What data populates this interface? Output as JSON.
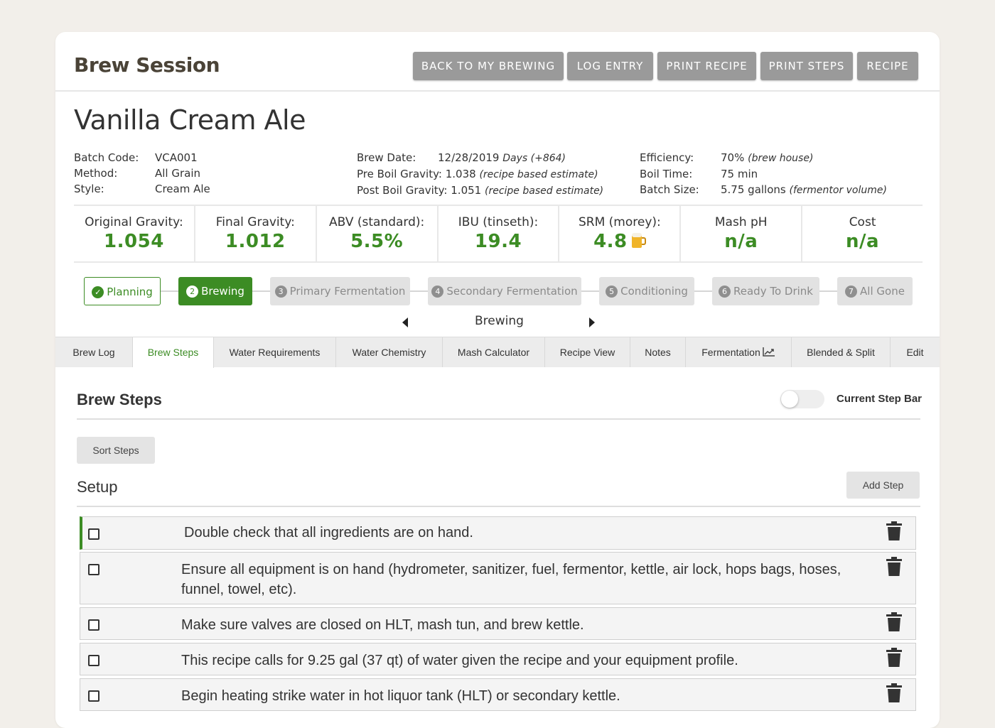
{
  "header": {
    "title": "Brew Session",
    "buttons": [
      "BACK TO MY BREWING",
      "LOG ENTRY",
      "PRINT RECIPE",
      "PRINT STEPS",
      "RECIPE"
    ]
  },
  "recipe": {
    "name": "Vanilla Cream Ale",
    "batch_code_label": "Batch Code:",
    "batch_code": "VCA001",
    "method_label": "Method:",
    "method": "All Grain",
    "style_label": "Style:",
    "style": "Cream Ale",
    "brew_date_label": "Brew Date:",
    "brew_date": "12/28/2019",
    "brew_date_days": "Days (+864)",
    "pre_boil_label": "Pre Boil Gravity:",
    "pre_boil": "1.038",
    "pre_boil_note": "(recipe based estimate)",
    "post_boil_label": "Post Boil Gravity:",
    "post_boil": "1.051",
    "post_boil_note": "(recipe based estimate)",
    "efficiency_label": "Efficiency:",
    "efficiency": "70%",
    "efficiency_note": "(brew house)",
    "boil_time_label": "Boil Time:",
    "boil_time": "75 min",
    "batch_size_label": "Batch Size:",
    "batch_size": "5.75 gallons",
    "batch_size_note": "(fermentor volume)"
  },
  "stats": [
    {
      "label": "Original Gravity:",
      "value": "1.054"
    },
    {
      "label": "Final Gravity:",
      "value": "1.012"
    },
    {
      "label": "ABV (standard):",
      "value": "5.5%"
    },
    {
      "label": "IBU (tinseth):",
      "value": "19.4"
    },
    {
      "label": "SRM (morey):",
      "value": "4.8"
    },
    {
      "label": "Mash pH",
      "value": "n/a"
    },
    {
      "label": "Cost",
      "value": "n/a"
    }
  ],
  "stages": [
    {
      "num": "✓",
      "label": "Planning",
      "state": "done"
    },
    {
      "num": "2",
      "label": "Brewing",
      "state": "active"
    },
    {
      "num": "3",
      "label": "Primary Fermentation",
      "state": "future"
    },
    {
      "num": "4",
      "label": "Secondary Fermentation",
      "state": "future"
    },
    {
      "num": "5",
      "label": "Conditioning",
      "state": "future"
    },
    {
      "num": "6",
      "label": "Ready To Drink",
      "state": "future"
    },
    {
      "num": "7",
      "label": "All Gone",
      "state": "future"
    }
  ],
  "stage_nav": {
    "current": "Brewing"
  },
  "tabs": [
    "Brew Log",
    "Brew Steps",
    "Water Requirements",
    "Water Chemistry",
    "Mash Calculator",
    "Recipe View",
    "Notes",
    "Fermentation",
    "Blended & Split",
    "Edit"
  ],
  "active_tab": "Brew Steps",
  "brew_steps": {
    "title": "Brew Steps",
    "toggle_label": "Current Step Bar",
    "toggle_on": false,
    "sort_label": "Sort Steps",
    "add_label": "Add Step",
    "section": "Setup",
    "steps": [
      "Double check that all ingredients are on hand.",
      "Ensure all equipment is on hand (hydrometer, sanitizer, fuel, fermentor, kettle, air lock, hops bags, hoses, funnel, towel, etc).",
      "Make sure valves are closed on HLT, mash tun, and brew kettle.",
      "This recipe calls for 9.25 gal (37 qt) of water given the recipe and your equipment profile.",
      "Begin heating strike water in hot liquor tank (HLT) or secondary kettle."
    ]
  },
  "colors": {
    "accent": "#3c8c24",
    "button_gray": "#9a9a9a",
    "background": "#f2efea"
  },
  "icons": [
    "check-circle-icon",
    "beer-mug-icon",
    "chevron-left-icon",
    "chevron-right-icon",
    "chart-icon",
    "trash-icon",
    "checkbox-icon"
  ]
}
